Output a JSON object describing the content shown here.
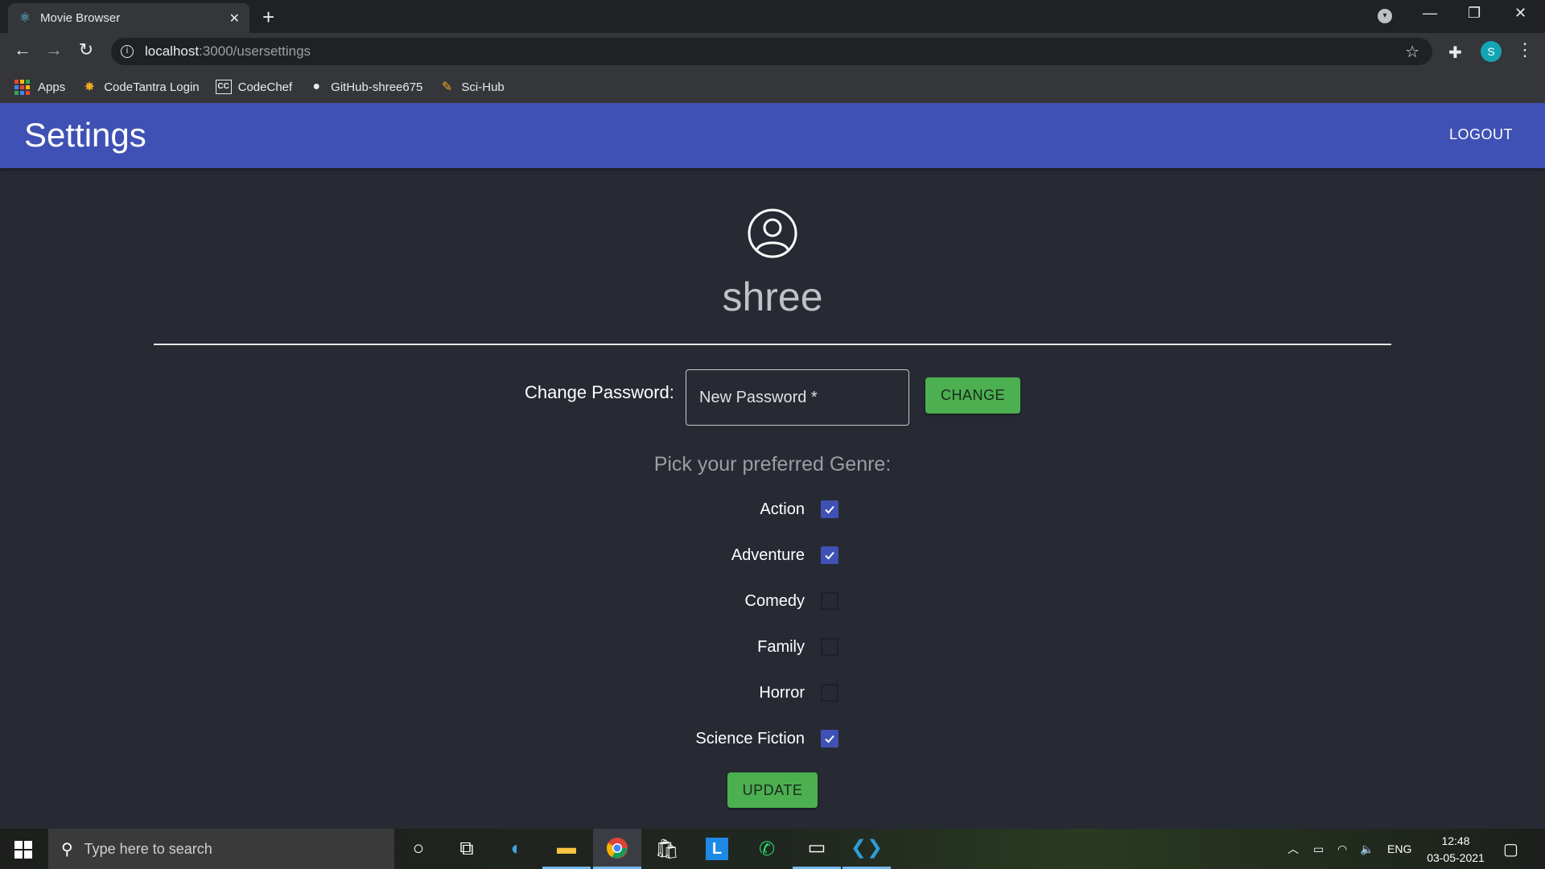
{
  "browser": {
    "tab_title": "Movie Browser",
    "url_host": "localhost",
    "url_path": ":3000/usersettings",
    "profile_initial": "S",
    "bookmarks": [
      {
        "label": "Apps",
        "icon": "apps-grid-icon"
      },
      {
        "label": "CodeTantra Login",
        "icon": "codetantra-icon"
      },
      {
        "label": "CodeChef",
        "icon": "codechef-icon"
      },
      {
        "label": "GitHub-shree675",
        "icon": "github-icon"
      },
      {
        "label": "Sci-Hub",
        "icon": "scihub-icon"
      }
    ]
  },
  "appbar": {
    "title": "Settings",
    "logout_label": "LOGOUT",
    "color": "#3f51b5"
  },
  "profile": {
    "icon": "user-circle-icon",
    "username": "shree"
  },
  "password": {
    "label": "Change Password:",
    "placeholder": "New Password *",
    "value": "",
    "button_label": "CHANGE"
  },
  "genres": {
    "heading": "Pick your preferred Genre:",
    "items": [
      {
        "label": "Action",
        "checked": true
      },
      {
        "label": "Adventure",
        "checked": true
      },
      {
        "label": "Comedy",
        "checked": false
      },
      {
        "label": "Family",
        "checked": false
      },
      {
        "label": "Horror",
        "checked": false
      },
      {
        "label": "Science Fiction",
        "checked": true
      }
    ],
    "update_label": "UPDATE"
  },
  "taskbar": {
    "search_placeholder": "Type here to search",
    "language": "ENG",
    "time": "12:48",
    "date": "03-05-2021"
  }
}
